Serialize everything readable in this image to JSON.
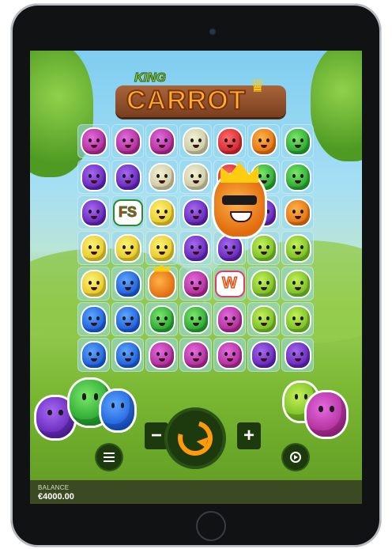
{
  "game": {
    "logo_top": "KING",
    "logo_main": "CARROT"
  },
  "grid": {
    "rows": [
      [
        "grape",
        "grape",
        "grape",
        "pear",
        "straw",
        "orange",
        "melon"
      ],
      [
        "plum",
        "plum",
        "pear",
        "pear",
        "straw",
        "melon",
        "melon"
      ],
      [
        "plum",
        "fs",
        "lemon",
        "plum",
        "king-big",
        "plum",
        "orange"
      ],
      [
        "lemon",
        "lemon",
        "lemon",
        "plum",
        "plum",
        "apple",
        "apple"
      ],
      [
        "lemon",
        "blue",
        "king",
        "grape",
        "wild",
        "apple",
        "apple"
      ],
      [
        "blue",
        "blue",
        "melon",
        "melon",
        "grape",
        "apple",
        "apple"
      ],
      [
        "blue",
        "blue",
        "grape",
        "grape",
        "grape",
        "plum",
        "plum"
      ]
    ],
    "fs_label": "FS",
    "wild_label": "W"
  },
  "controls": {
    "minus_label": "−",
    "plus_label": "+",
    "menu_icon": "hamburger-icon",
    "autoplay_icon": "autoplay-icon",
    "spin_icon": "spin-arrow-icon"
  },
  "footer": {
    "balance_label": "BALANCE",
    "balance_value": "€4000.00"
  },
  "colors": {
    "accent": "#ff9a0a",
    "button_bg": "#1d3a0f",
    "bar_bg": "#3b4a22"
  }
}
